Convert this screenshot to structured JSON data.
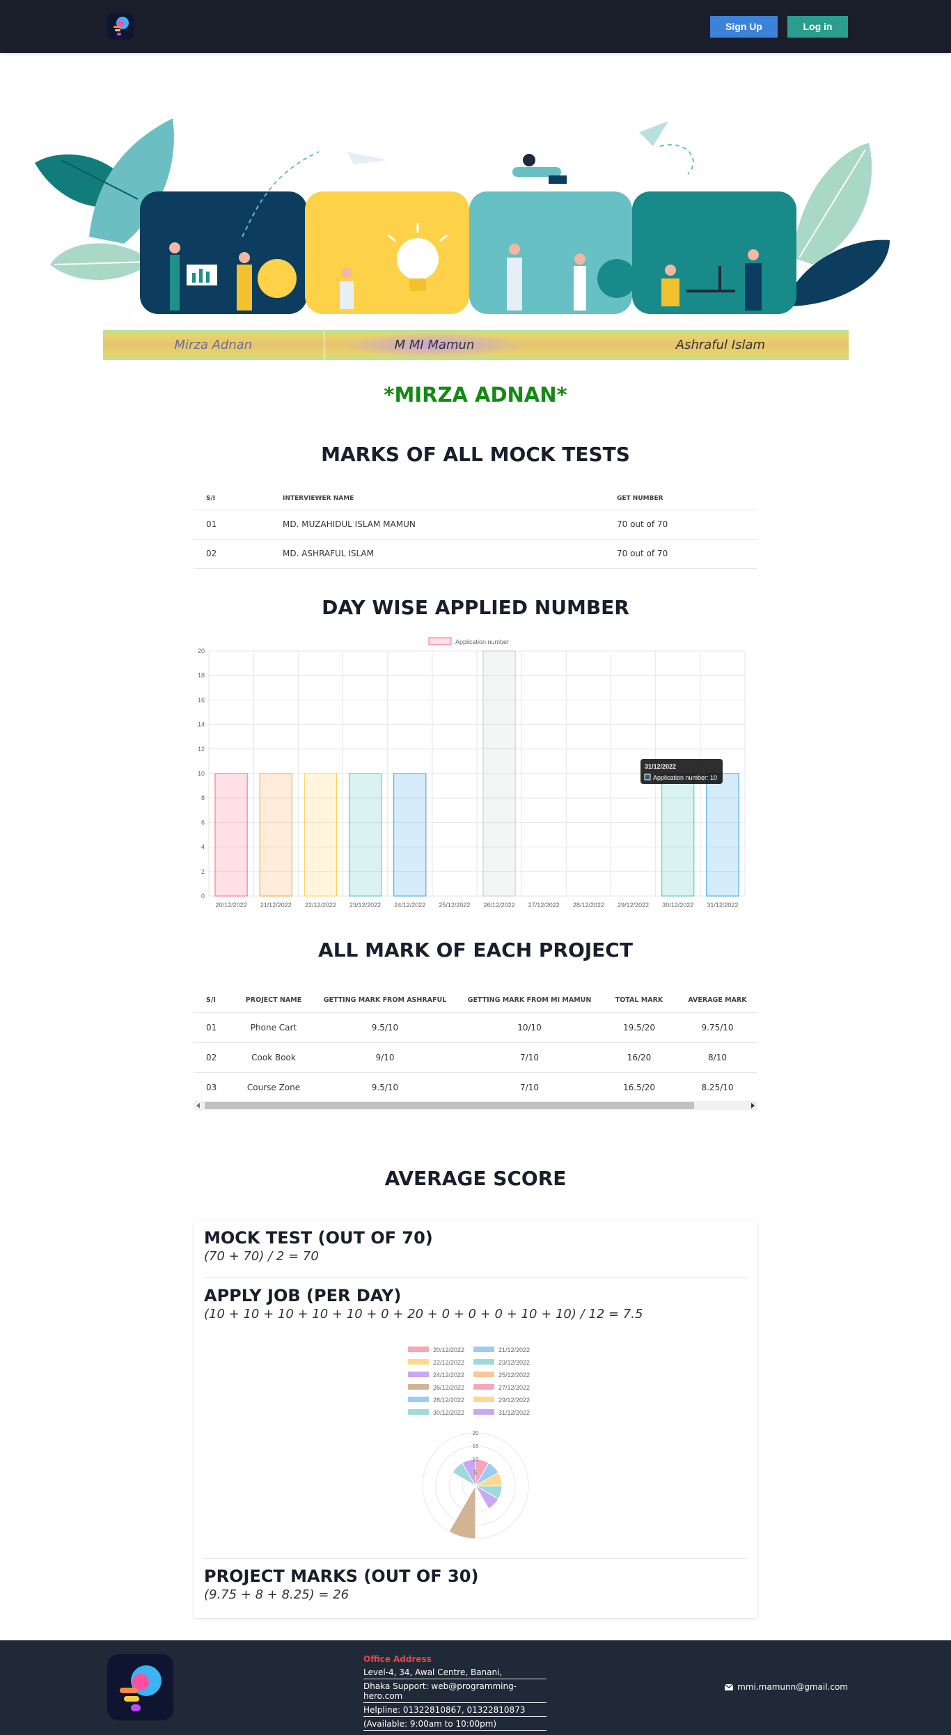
{
  "nav": {
    "signup_label": "Sign Up",
    "login_label": "Log in"
  },
  "names_strip": [
    "Mirza Adnan",
    "M MI Mamun",
    "Ashraful Islam"
  ],
  "student_name": "*MIRZA ADNAN*",
  "mock": {
    "title": "MARKS OF ALL MOCK TESTS",
    "headers": [
      "S/I",
      "INTERVIEWER NAME",
      "GET NUMBER"
    ],
    "rows": [
      [
        "01",
        "MD. MUZAHIDUL ISLAM MAMUN",
        "70 out of 70"
      ],
      [
        "02",
        "MD. ASHRAFUL ISLAM",
        "70 out of 70"
      ]
    ]
  },
  "day_wise": {
    "title": "DAY WISE APPLIED NUMBER"
  },
  "chart_data": [
    {
      "type": "bar",
      "legend": [
        "Application number"
      ],
      "legend_position": "top",
      "categories": [
        "20/12/2022",
        "21/12/2022",
        "22/12/2022",
        "23/12/2022",
        "24/12/2022",
        "25/12/2022",
        "26/12/2022",
        "27/12/2022",
        "28/12/2022",
        "29/12/2022",
        "30/12/2022",
        "31/12/2022"
      ],
      "series": [
        {
          "name": "Application number",
          "values": [
            10,
            10,
            10,
            10,
            10,
            0,
            20,
            0,
            0,
            0,
            10,
            10
          ]
        }
      ],
      "colors": [
        "#ff6384",
        "#ff9f40",
        "#ffcd56",
        "#4bc0c0",
        "#36a2eb",
        "#9966ff",
        "#c9cbcf",
        "#ff6384",
        "#ff9f40",
        "#ffcd56",
        "#4bc0c0",
        "#36a2eb"
      ],
      "yticks": [
        "0",
        "2",
        "4",
        "6",
        "8",
        "10",
        "12",
        "14",
        "16",
        "18",
        "20"
      ],
      "ylim": [
        0,
        20
      ],
      "grid": true,
      "tooltip": {
        "title": "31/12/2022",
        "body": "Application number: 10"
      }
    },
    {
      "type": "polarArea",
      "legend": [
        "20/12/2022",
        "21/12/2022",
        "22/12/2022",
        "23/12/2022",
        "24/12/2022",
        "25/12/2022",
        "26/12/2022",
        "27/12/2022",
        "28/12/2022",
        "29/12/2022",
        "30/12/2022",
        "31/12/2022"
      ],
      "legend_position": "top",
      "values": [
        10,
        10,
        10,
        10,
        10,
        0,
        20,
        0,
        0,
        0,
        10,
        10
      ],
      "colors": [
        "#f7a6b8",
        "#9ecbf1",
        "#fcd98f",
        "#9fdada",
        "#c9a7f5",
        "#fcc798",
        "#d2b394",
        "#f7a6b8",
        "#9ecbf1",
        "#fcd98f",
        "#9fdada",
        "#c9a7f5"
      ],
      "rticks": [
        "5",
        "10",
        "15",
        "20"
      ],
      "rlim": [
        0,
        20
      ]
    }
  ],
  "projects": {
    "title": "ALL MARK OF EACH PROJECT",
    "headers": [
      "S/I",
      "PROJECT NAME",
      "GETTING MARK FROM ASHRAFUL",
      "GETTING MARK FROM MI MAMUN",
      "TOTAL MARK",
      "AVERAGE MARK"
    ],
    "rows": [
      [
        "01",
        "Phone Cart",
        "9.5/10",
        "10/10",
        "19.5/20",
        "9.75/10"
      ],
      [
        "02",
        "Cook Book",
        "9/10",
        "7/10",
        "16/20",
        "8/10"
      ],
      [
        "03",
        "Course Zone",
        "9.5/10",
        "7/10",
        "16.5/20",
        "8.25/10"
      ]
    ]
  },
  "average": {
    "title": "AVERAGE SCORE",
    "mock_heading": "MOCK TEST (OUT OF 70)",
    "mock_formula": "(70 + 70) / 2 = 70",
    "apply_heading": "APPLY JOB (PER DAY)",
    "apply_formula": "(10 + 10 + 10 + 10 + 10 + 0 + 20 + 0 + 0 + 0 + 10 + 10) / 12 = 7.5",
    "project_heading": "PROJECT MARKS (OUT OF 30)",
    "project_formula": "(9.75 + 8 + 8.25) = 26"
  },
  "footer": {
    "office_title": "Office Address",
    "office_lines": [
      "Level-4, 34, Awal Centre, Banani,",
      "Dhaka Support: web@programming-hero.com",
      "Helpline: 01322810867, 01322810873",
      "(Available: 9:00am to 10:00pm)"
    ],
    "email": "mmi.mamunn@gmail.com"
  }
}
